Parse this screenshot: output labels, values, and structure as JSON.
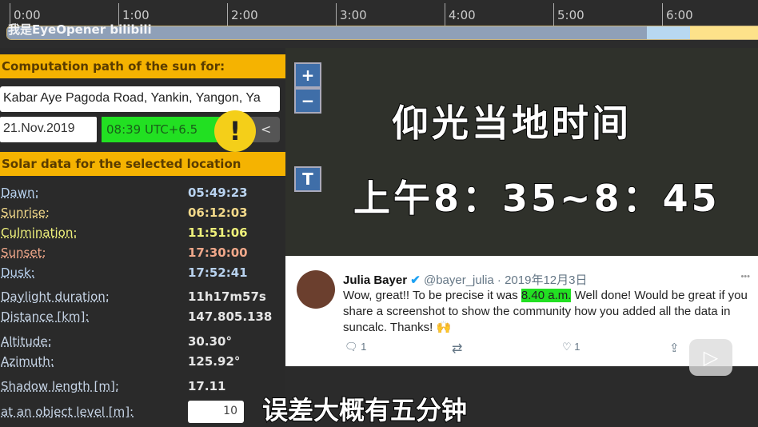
{
  "timeline": {
    "ticks": [
      "0:00",
      "1:00",
      "2:00",
      "3:00",
      "4:00",
      "5:00",
      "6:00"
    ],
    "colors": {
      "night": "#8fa0b8",
      "twilight": "#b8d8f0",
      "day": "#fde28a"
    }
  },
  "watermark": "我是EyeOpener bilibili",
  "panel": {
    "header": "Computation path of the sun for:",
    "address": "Kabar Aye Pagoda Road, Yankin, Yangon, Ya",
    "date": "21.Nov.2019",
    "time": "08:39 UTC+6.5",
    "prev_label": "<",
    "warn": "!",
    "solar_header": "Solar data for the selected location",
    "rows": [
      {
        "label": "Dawn:",
        "value": "05:49:23",
        "color": "#b9d3f0"
      },
      {
        "label": "Sunrise:",
        "value": "06:12:03",
        "color": "#f3d98a"
      },
      {
        "label": "Culmination:",
        "value": "11:51:06",
        "color": "#eef07a"
      },
      {
        "label": "Sunset:",
        "value": "17:30:00",
        "color": "#f0a88a"
      },
      {
        "label": "Dusk:",
        "value": "17:52:41",
        "color": "#b9d3f0"
      },
      {
        "label": "Daylight duration:",
        "value": "11h17m57s",
        "color": "#e6e6e6"
      },
      {
        "label": "Distance [km]:",
        "value": "147.805.138",
        "color": "#e6e6e6"
      },
      {
        "label": "Altitude:",
        "value": "30.30°",
        "color": "#e6e6e6"
      },
      {
        "label": "Azimuth:",
        "value": "125.92°",
        "color": "#e6e6e6"
      },
      {
        "label": "Shadow length [m]:",
        "value": "17.11",
        "color": "#e6e6e6"
      }
    ],
    "object_level_label": "at an object level [m]:",
    "object_level_value": "10"
  },
  "map": {
    "zoom_in": "+",
    "zoom_out": "−",
    "t_button": "T"
  },
  "overlay": {
    "line1": "仰光当地时间",
    "line2": "上午8：35~8：45"
  },
  "tweet": {
    "name": "Julia Bayer",
    "handle": "@bayer_julia · 2019年12月3日",
    "text_before": "Wow, great!! To be precise it was ",
    "highlight": "8.40 a.m.",
    "text_after": " Well done! Would be great if you share a screenshot to show the community how you added all the data in suncalc. Thanks! 🙌",
    "replies": "1",
    "likes": "1",
    "more": "•••"
  },
  "subtitle": "误差大概有五分钟"
}
